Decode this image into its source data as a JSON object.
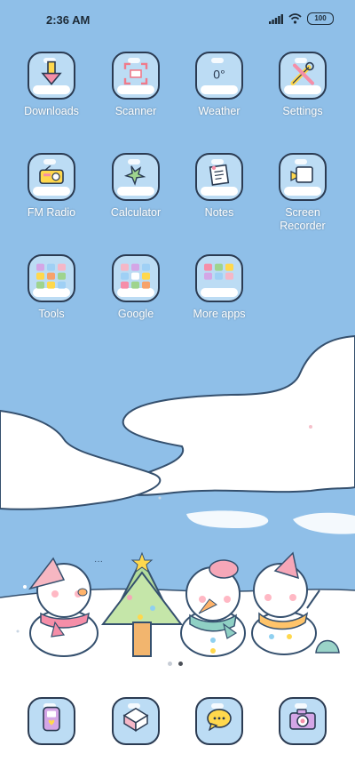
{
  "status_bar": {
    "time": "2:36 AM",
    "battery": "100"
  },
  "apps": [
    {
      "label": "Downloads",
      "icon": "download-icon"
    },
    {
      "label": "Scanner",
      "icon": "scanner-icon"
    },
    {
      "label": "Weather",
      "icon": "weather-icon",
      "temp": "0°"
    },
    {
      "label": "Settings",
      "icon": "settings-icon"
    },
    {
      "label": "FM Radio",
      "icon": "radio-icon"
    },
    {
      "label": "Calculator",
      "icon": "calculator-icon"
    },
    {
      "label": "Notes",
      "icon": "notes-icon"
    },
    {
      "label": "Screen Recorder",
      "icon": "screen-recorder-icon"
    },
    {
      "label": "Tools",
      "icon": "folder-icon"
    },
    {
      "label": "Google",
      "icon": "folder-icon"
    },
    {
      "label": "More apps",
      "icon": "folder-icon"
    }
  ],
  "dock": [
    {
      "icon": "phone-icon"
    },
    {
      "icon": "messages-icon"
    },
    {
      "icon": "chat-icon"
    },
    {
      "icon": "camera-icon"
    }
  ],
  "pages": {
    "count": 2,
    "active": 2
  },
  "colors": {
    "sky": "#8fbfe8",
    "snow": "#ffffff",
    "icon_bg": "#bcdcf4",
    "icon_border": "#2b3b52"
  }
}
